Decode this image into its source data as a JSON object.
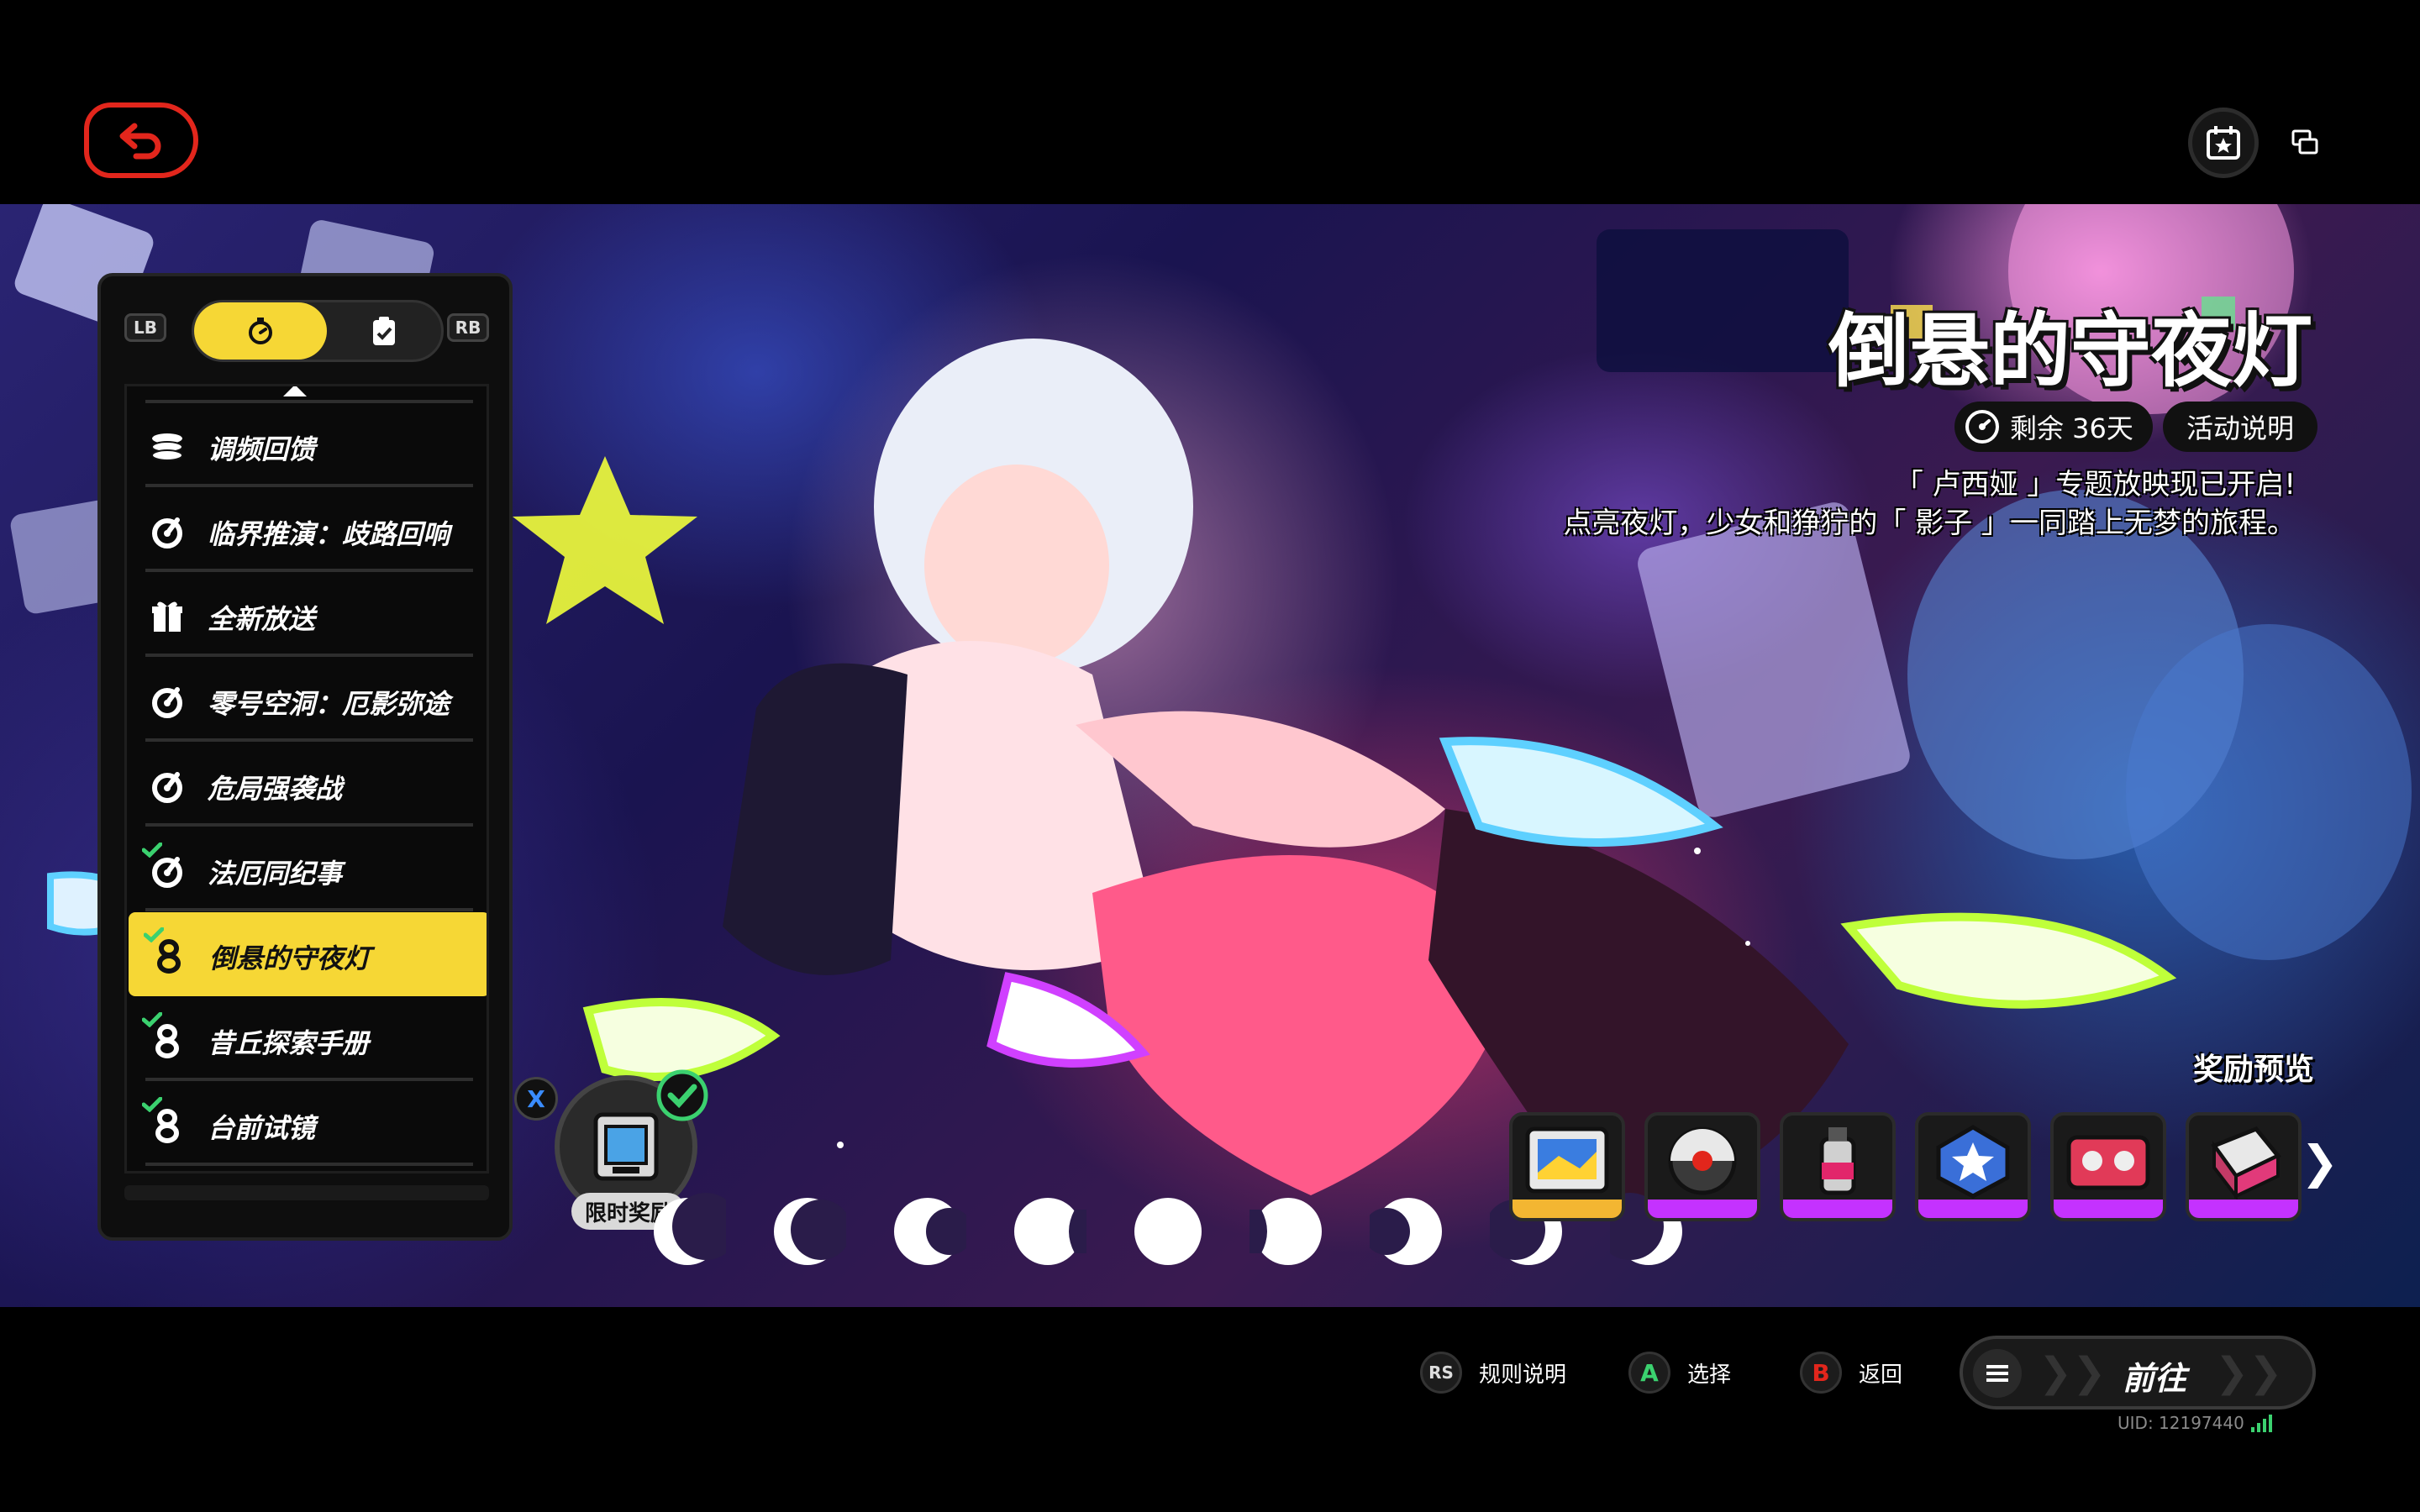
{
  "header": {
    "back_icon": "back-arrow-icon",
    "calendar_icon": "calendar-star-icon",
    "window_icon": "window-switch-icon"
  },
  "menu": {
    "lb_label": "LB",
    "rb_label": "RB",
    "tabs": [
      {
        "icon": "stopwatch-icon",
        "active": true
      },
      {
        "icon": "clipboard-check-icon",
        "active": false
      }
    ],
    "items": [
      {
        "label": "调频回馈",
        "icon": "coins-icon",
        "checked": false,
        "active": false
      },
      {
        "label": "临界推演：歧路回响",
        "icon": "challenge-icon",
        "checked": false,
        "active": false
      },
      {
        "label": "全新放送",
        "icon": "gift-icon",
        "checked": false,
        "active": false
      },
      {
        "label": "零号空洞：厄影弥途",
        "icon": "challenge-icon",
        "checked": false,
        "active": false
      },
      {
        "label": "危局强袭战",
        "icon": "challenge-icon",
        "checked": false,
        "active": false
      },
      {
        "label": "法厄同纪事",
        "icon": "challenge-icon",
        "checked": true,
        "active": false
      },
      {
        "label": "倒悬的守夜灯",
        "icon": "event-8-icon",
        "checked": true,
        "active": true
      },
      {
        "label": "昔丘探索手册",
        "icon": "event-8-icon",
        "checked": true,
        "active": false
      },
      {
        "label": "台前试镜",
        "icon": "event-8-icon",
        "checked": true,
        "active": false
      }
    ]
  },
  "event": {
    "title": "倒悬的守夜灯",
    "remaining": "剩余 36天",
    "info_button": "活动说明",
    "desc_line1": "「 卢西娅 」专题放映现已开启!",
    "desc_line2": "点亮夜灯，少女和狰狞的「 影子 」一同踏上无梦的旅程。"
  },
  "limited_reward": {
    "label": "限时奖励",
    "key": "X",
    "claimed": true
  },
  "rewards": {
    "title": "奖励预览",
    "items": [
      {
        "icon": "film-reel-icon",
        "rarity": "gold"
      },
      {
        "icon": "drive-disc-icon",
        "rarity": "purple"
      },
      {
        "icon": "spray-can-icon",
        "rarity": "purple"
      },
      {
        "icon": "badge-star-icon",
        "rarity": "purple"
      },
      {
        "icon": "cassette-tape-icon",
        "rarity": "purple"
      },
      {
        "icon": "crate-icon",
        "rarity": "purple"
      }
    ],
    "more_icon": "chevron-right-icon"
  },
  "moon_phases": [
    "waxing-crescent",
    "crescent",
    "first-quarter",
    "waxing-gibbous",
    "full",
    "waning-gibbous",
    "last-quarter",
    "waning-crescent",
    "new-crescent"
  ],
  "footer": {
    "hints": [
      {
        "key": "RS",
        "label": "规则说明",
        "color": "#dddddd"
      },
      {
        "key": "A",
        "label": "选择",
        "color": "#3bd16f"
      },
      {
        "key": "B",
        "label": "返回",
        "color": "#e2261c"
      }
    ],
    "go_label": "前往",
    "uid": "UID: 12197440"
  },
  "colors": {
    "accent_yellow": "#f6d735",
    "back_red": "#e2261c",
    "rarity_purple": "#c432ff",
    "rarity_gold": "#f3b632"
  }
}
